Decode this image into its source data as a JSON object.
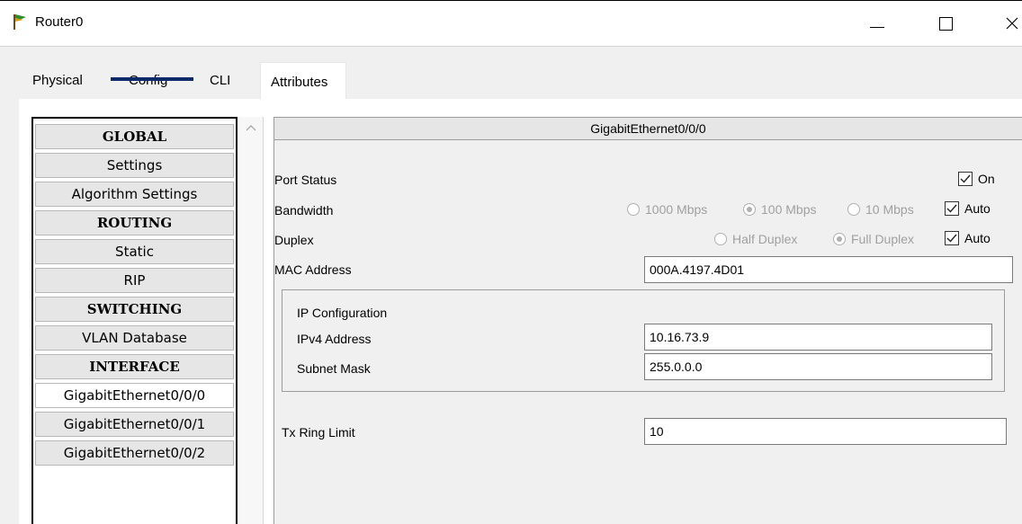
{
  "window": {
    "title": "Router0",
    "minimize": "—",
    "maximize": "☐",
    "close": "✕"
  },
  "tabs": [
    "Physical",
    "Config",
    "CLI",
    "Attributes"
  ],
  "sidebar": {
    "items": [
      {
        "label": "GLOBAL",
        "type": "header"
      },
      {
        "label": "Settings",
        "type": "item"
      },
      {
        "label": "Algorithm Settings",
        "type": "item"
      },
      {
        "label": "ROUTING",
        "type": "header"
      },
      {
        "label": "Static",
        "type": "item"
      },
      {
        "label": "RIP",
        "type": "item"
      },
      {
        "label": "SWITCHING",
        "type": "header"
      },
      {
        "label": "VLAN Database",
        "type": "item"
      },
      {
        "label": "INTERFACE",
        "type": "header"
      },
      {
        "label": "GigabitEthernet0/0/0",
        "type": "item",
        "active": true
      },
      {
        "label": "GigabitEthernet0/0/1",
        "type": "item"
      },
      {
        "label": "GigabitEthernet0/0/2",
        "type": "item"
      }
    ]
  },
  "panel": {
    "title": "GigabitEthernet0/0/0",
    "port_status_label": "Port Status",
    "port_status_on": "On",
    "bandwidth_label": "Bandwidth",
    "bandwidth_options": [
      "1000 Mbps",
      "100 Mbps",
      "10 Mbps"
    ],
    "bandwidth_selected": "100 Mbps",
    "bandwidth_auto": "Auto",
    "duplex_label": "Duplex",
    "duplex_options": [
      "Half Duplex",
      "Full Duplex"
    ],
    "duplex_selected": "Full Duplex",
    "duplex_auto": "Auto",
    "mac_label": "MAC Address",
    "mac_value": "000A.4197.4D01",
    "ip_config_label": "IP Configuration",
    "ipv4_label": "IPv4 Address",
    "ipv4_value": "10.16.73.9",
    "subnet_label": "Subnet Mask",
    "subnet_value": "255.0.0.0",
    "tx_label": "Tx Ring Limit",
    "tx_value": "10"
  },
  "colors": {
    "tab_underline": "#0a2a6a",
    "background": "#f0f0f0"
  }
}
